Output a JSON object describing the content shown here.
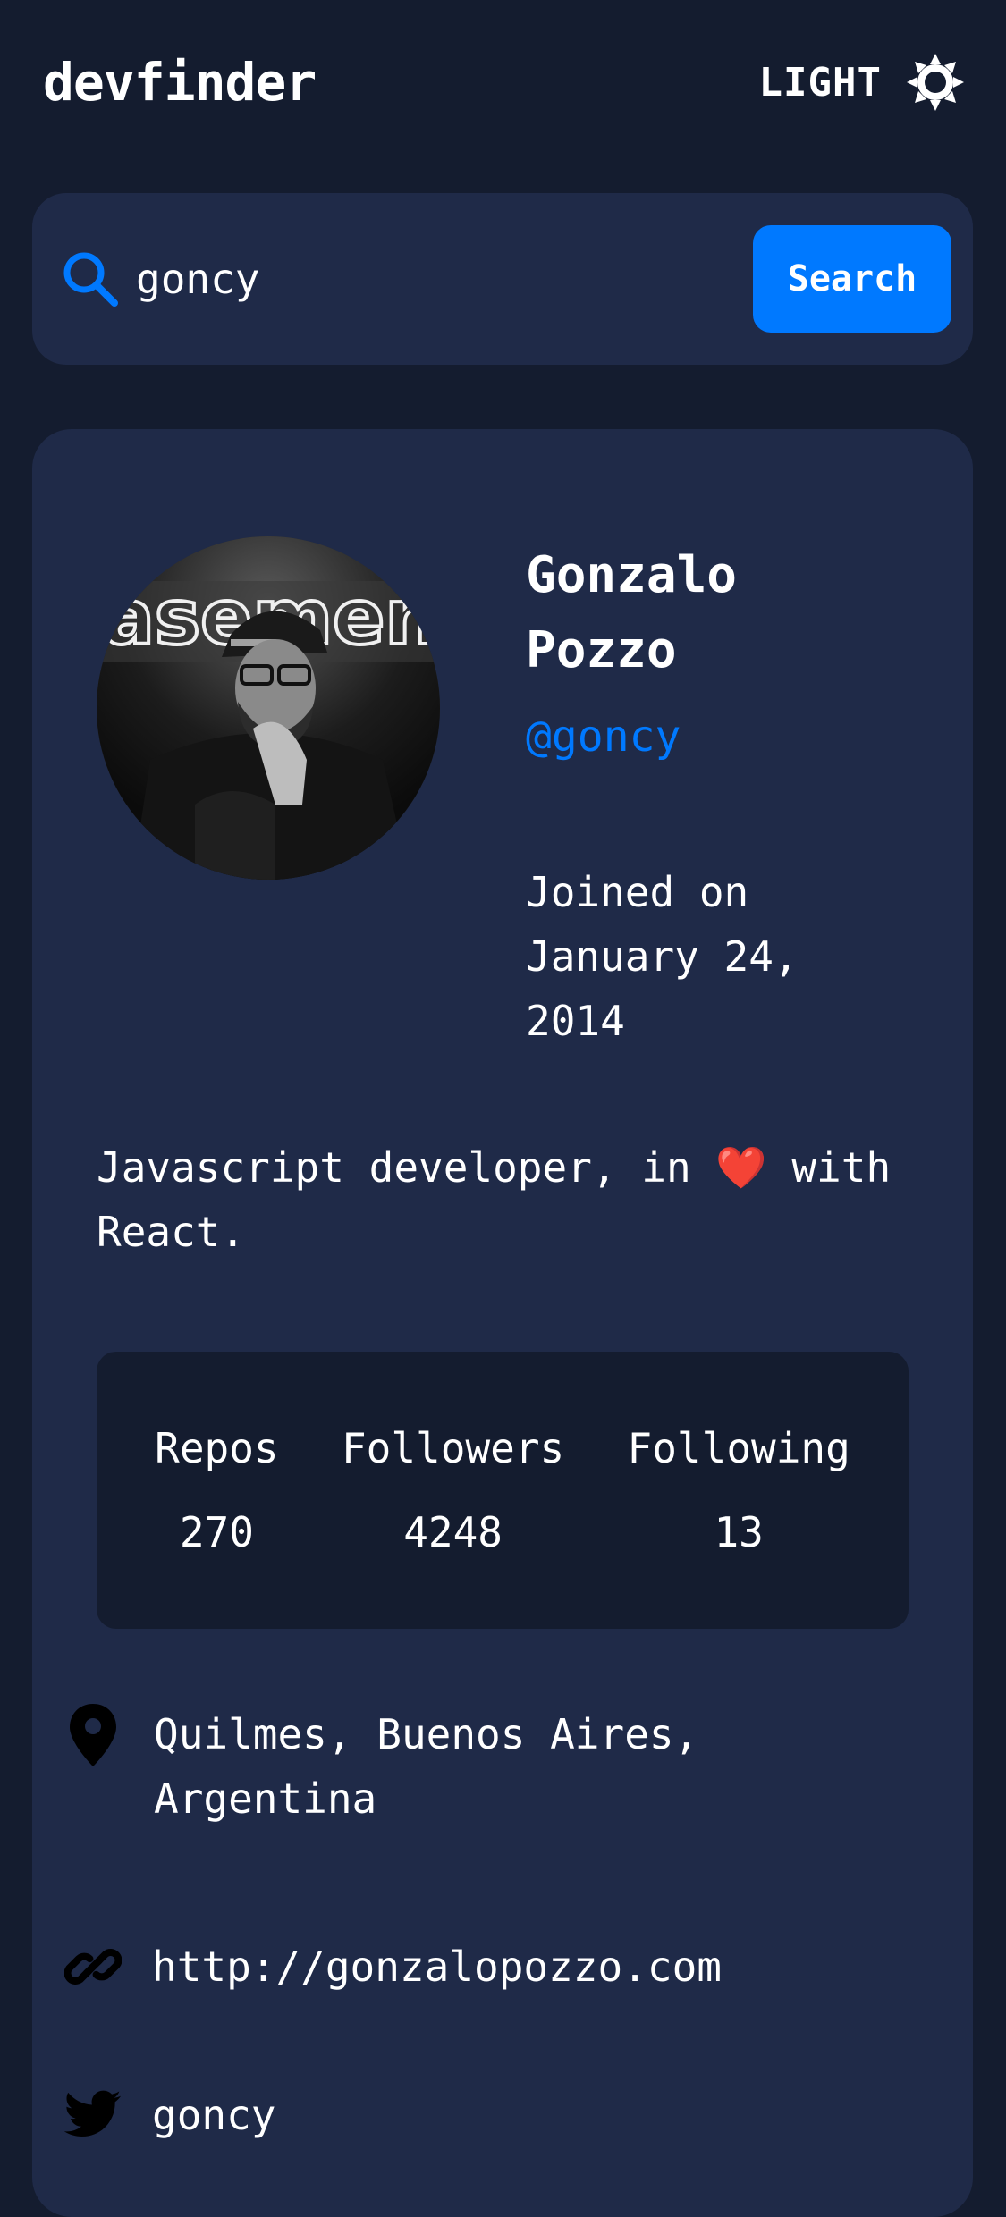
{
  "header": {
    "logo": "devfinder",
    "theme_label": "LIGHT",
    "theme_icon": "sun-icon"
  },
  "search": {
    "value": "goncy",
    "placeholder": "",
    "button_label": "Search",
    "icon": "search-icon"
  },
  "profile": {
    "name": "Gonzalo Pozzo",
    "login": "@goncy",
    "joined": "Joined on January 24, 2014",
    "bio_text": "Javascript developer, in",
    "bio_emoji": "❤️",
    "bio_tail": "with React.",
    "avatar_sign": "basement"
  },
  "stats": [
    {
      "label": "Repos",
      "value": "270"
    },
    {
      "label": "Followers",
      "value": "4248"
    },
    {
      "label": "Following",
      "value": "13"
    }
  ],
  "links": {
    "location": "Quilmes, Buenos Aires, Argentina",
    "website": "http://gonzalopozzo.com",
    "twitter": "goncy"
  },
  "colors": {
    "background": "#141c2f",
    "card": "#1f2a48",
    "accent": "#0079ff",
    "text": "#ffffff"
  }
}
